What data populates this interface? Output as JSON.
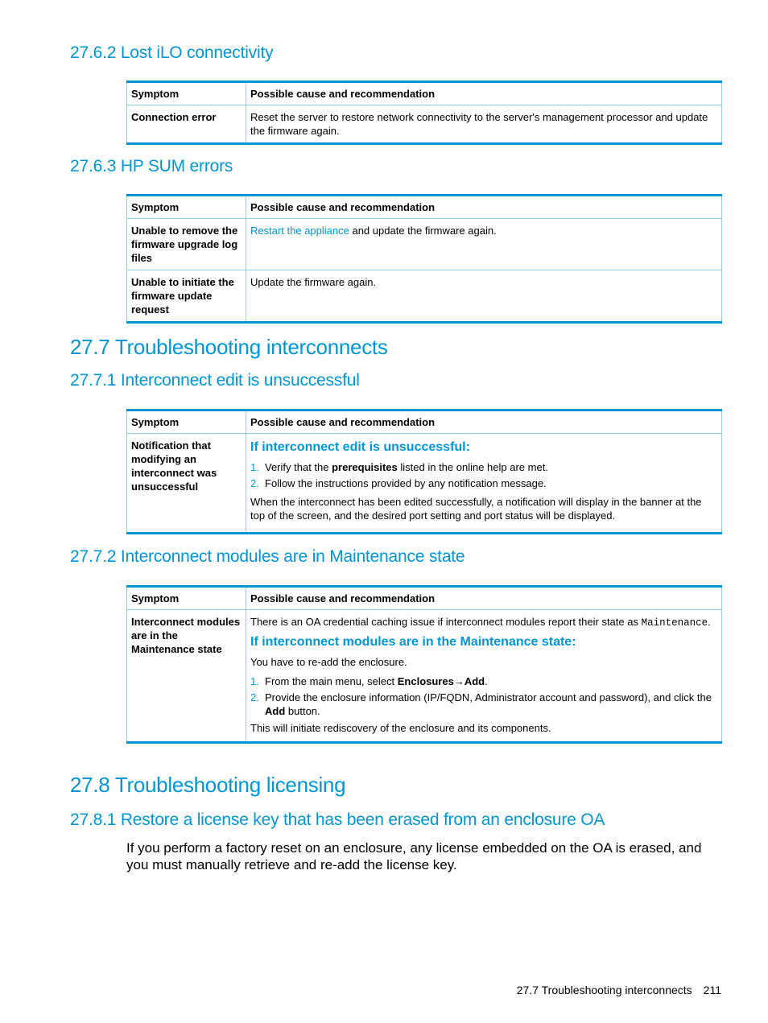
{
  "sections": {
    "s2762": {
      "title": "27.6.2 Lost iLO connectivity"
    },
    "s2763": {
      "title": "27.6.3 HP SUM errors"
    },
    "s277": {
      "title": "27.7 Troubleshooting interconnects"
    },
    "s2771": {
      "title": "27.7.1 Interconnect edit is unsuccessful"
    },
    "s2772": {
      "title": "27.7.2 Interconnect modules are in Maintenance state"
    },
    "s278": {
      "title": "27.8 Troubleshooting licensing"
    },
    "s2781": {
      "title": "27.8.1 Restore a license key that has been erased from an enclosure OA"
    }
  },
  "table_headers": {
    "symptom": "Symptom",
    "cause": "Possible cause and recommendation"
  },
  "ilo_table": {
    "rows": [
      {
        "symptom": "Connection error",
        "cause": "Reset the server to restore network connectivity to the server's management processor and update the firmware again."
      }
    ]
  },
  "sum_table": {
    "rows": [
      {
        "symptom": "Unable to remove the firmware upgrade log files",
        "cause_link": "Restart the appliance",
        "cause_rest": " and update the firmware again."
      },
      {
        "symptom": "Unable to initiate the firmware update request",
        "cause": "Update the firmware again."
      }
    ]
  },
  "interconnect_edit_table": {
    "rows": [
      {
        "symptom": "Notification that modifying an interconnect was unsuccessful",
        "procedure_title": "If interconnect edit is unsuccessful:",
        "steps": [
          {
            "num": "1.",
            "pre": "Verify that the ",
            "bold": "prerequisites",
            "post": " listed in the online help are met."
          },
          {
            "num": "2.",
            "text": "Follow the instructions provided by any notification message."
          }
        ],
        "note": "When the interconnect has been edited successfully, a notification will display in the banner at the top of the screen, and the desired port setting and port status will be displayed."
      }
    ]
  },
  "maintenance_table": {
    "rows": [
      {
        "symptom": "Interconnect modules are in the Maintenance state",
        "intro": "There is an OA credential caching issue if interconnect modules report their state as ",
        "intro_code": "Maintenance",
        "intro_end": ".",
        "procedure_title": "If interconnect modules are in the Maintenance state:",
        "lead": "You have to re-add the enclosure.",
        "steps": [
          {
            "num": "1.",
            "pre": "From the main menu, select ",
            "bold1": "Enclosures",
            "arrow": "→",
            "bold2": "Add",
            "post": "."
          },
          {
            "num": "2.",
            "pre": "Provide the enclosure information (IP/FQDN, Administrator account and password), and click the ",
            "bold": "Add",
            "post": " button."
          }
        ],
        "note": "This will initiate rediscovery of the enclosure and its components."
      }
    ]
  },
  "license_paragraph": "If you perform a factory reset on an enclosure, any license embedded on the OA is erased, and you must manually retrieve and re-add the license key.",
  "footer": {
    "section": "27.7 Troubleshooting interconnects",
    "page": "211"
  }
}
